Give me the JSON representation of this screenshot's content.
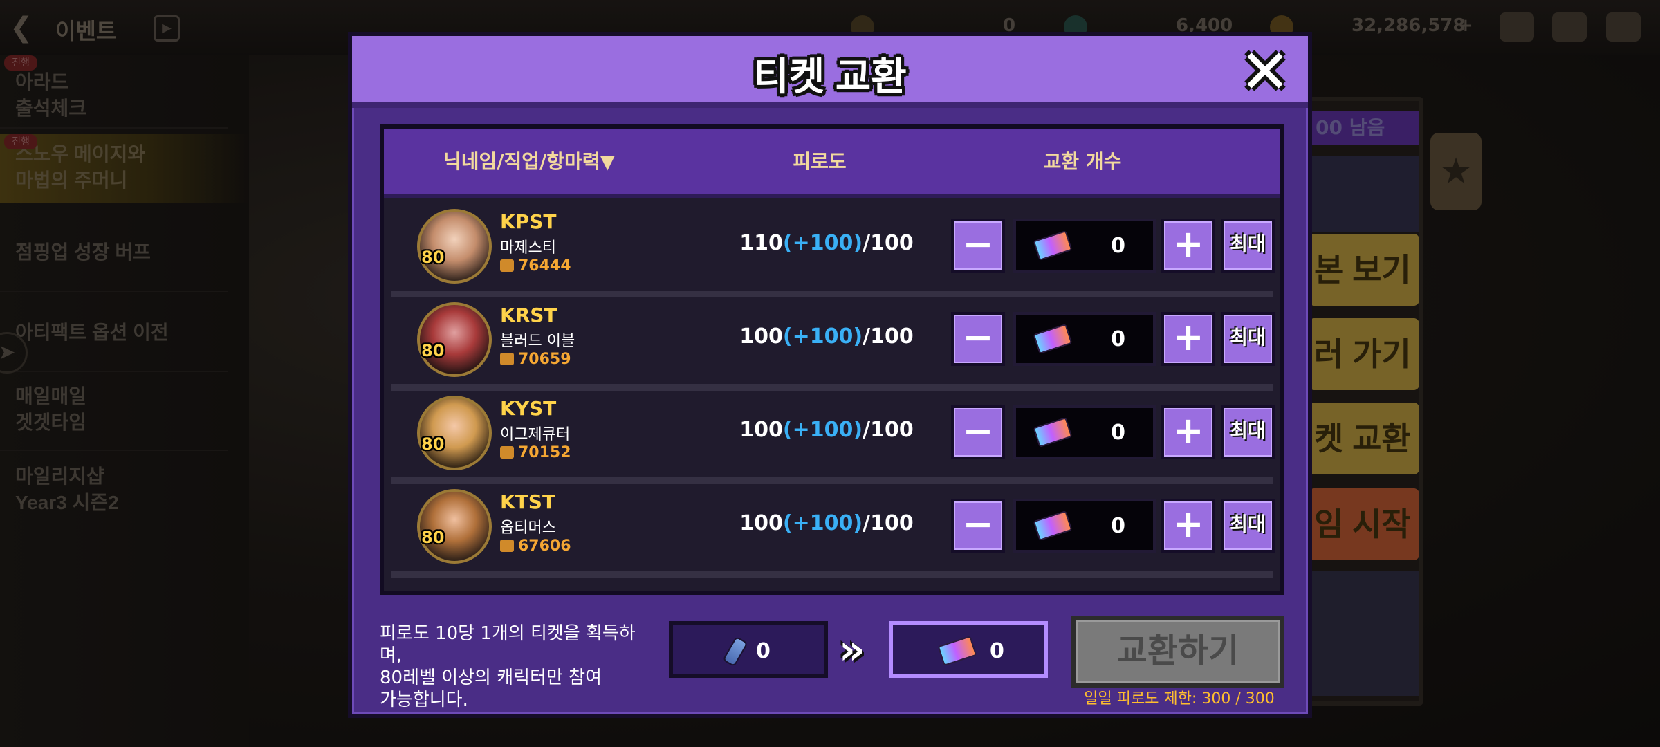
{
  "topbar": {
    "title": "이벤트",
    "currency_1": "0",
    "currency_2": "6,400",
    "gold": "32,286,578"
  },
  "sidebar": {
    "items": [
      {
        "badge": "진행",
        "label": "아라드\n출석체크"
      },
      {
        "badge": "진행",
        "label": "스노우 메이지와\n마법의 주머니"
      },
      {
        "label": "점핑업 성장 버프"
      },
      {
        "label": "아티팩트 옵션 이전"
      },
      {
        "label": "매일매일\n겟겟타임"
      },
      {
        "label": "마일리지샵\nYear3 시즌2"
      }
    ]
  },
  "right_panel": {
    "badge": "00 남음",
    "buttons": [
      "본 보기",
      "러 가기",
      "켓 교환",
      "임 시작"
    ]
  },
  "modal": {
    "title": "티켓 교환",
    "close_label": "✕",
    "headers": {
      "character": "닉네임/직업/항마력▼",
      "fatigue": "피로도",
      "exchange_count": "교환 개수"
    },
    "rows": [
      {
        "level": "80",
        "nickname": "KPST",
        "job": "마제스티",
        "power": "76444",
        "fatigue_current": "110",
        "fatigue_bonus": "(+100)",
        "fatigue_max": "/100",
        "count": "0"
      },
      {
        "level": "80",
        "nickname": "KRST",
        "job": "블러드 이블",
        "power": "70659",
        "fatigue_current": "100",
        "fatigue_bonus": "(+100)",
        "fatigue_max": "/100",
        "count": "0"
      },
      {
        "level": "80",
        "nickname": "KYST",
        "job": "이그제큐터",
        "power": "70152",
        "fatigue_current": "100",
        "fatigue_bonus": "(+100)",
        "fatigue_max": "/100",
        "count": "0"
      },
      {
        "level": "80",
        "nickname": "KTST",
        "job": "옵티머스",
        "power": "67606",
        "fatigue_current": "100",
        "fatigue_bonus": "(+100)",
        "fatigue_max": "/100",
        "count": "0"
      }
    ],
    "minus_label": "−",
    "plus_label": "+",
    "max_label": "최대",
    "note_line1": "피로도 10당 1개의 티켓을 획득하며,",
    "note_line2": "80레벨 이상의 캐릭터만 참여",
    "note_line3": "가능합니다.",
    "fatigue_total": "0",
    "ticket_total": "0",
    "exchange_button": "교환하기",
    "daily_limit": "일일 피로도 제한: 300 / 300"
  },
  "colors": {
    "modal_purple": "#9a6ee0",
    "panel_dark": "#201b2d",
    "bonus_blue": "#3ab0f5",
    "gold_text": "#ffd34a",
    "disabled_button": "#7a7a7a"
  }
}
